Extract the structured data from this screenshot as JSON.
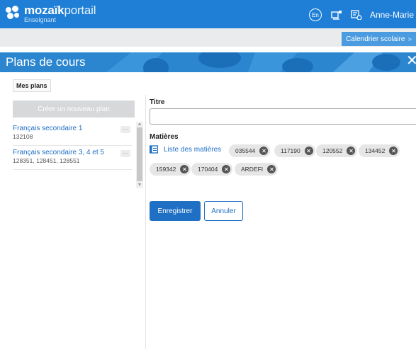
{
  "header": {
    "brand_bold": "mozaïk",
    "brand_light": "portail",
    "brand_role": "Enseignant",
    "language_button": "En",
    "user_name": "Anne-Marie",
    "brand_color": "#1f7fd6"
  },
  "calendar_link": {
    "label": "Calendrier scolaire",
    "arrow": "»"
  },
  "page": {
    "title": "Plans de cours",
    "close_glyph": "✕"
  },
  "sidebar": {
    "tab_label": "Mes plans",
    "create_button": "Créer un nouveau plan",
    "more_glyph": "...",
    "plans": [
      {
        "name": "Français secondaire 1",
        "codes": "132108"
      },
      {
        "name": "Français secondaire 3, 4 et 5",
        "codes": "128351, 128451, 128551"
      }
    ]
  },
  "form": {
    "title_label": "Titre",
    "title_value": "",
    "subjects_label": "Matières",
    "subjects_link": "Liste des matières",
    "subjects": [
      "035544",
      "117190",
      "120552",
      "134452",
      "159342",
      "170404",
      "ARDEFI"
    ],
    "save_button": "Enregistrer",
    "cancel_button": "Annuler",
    "accent_color": "#1f6fc4"
  }
}
